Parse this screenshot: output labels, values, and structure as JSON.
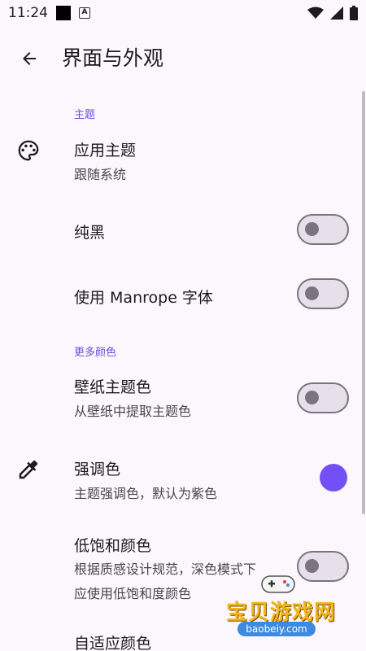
{
  "status_bar": {
    "time": "11:24",
    "icons": [
      "notification-square-icon",
      "a-badge-icon",
      "wifi-icon",
      "cell-signal-icon",
      "battery-icon"
    ]
  },
  "top_bar": {
    "back_icon": "arrow-back-icon",
    "title": "界面与外观"
  },
  "sections": {
    "theme": {
      "header": "主题",
      "app_theme": {
        "icon": "palette-icon",
        "title": "应用主题",
        "subtitle": "跟随系统"
      },
      "pure_black": {
        "title": "纯黑",
        "enabled": false
      },
      "manrope": {
        "title": "使用 Manrope 字体",
        "enabled": false
      }
    },
    "more_colors": {
      "header": "更多颜色",
      "wallpaper_color": {
        "title": "壁纸主题色",
        "subtitle": "从壁纸中提取主题色",
        "enabled": false
      },
      "accent_color": {
        "icon": "eyedropper-icon",
        "title": "强调色",
        "subtitle": "主题强调色，默认为紫色",
        "color": "#7350f5"
      },
      "low_saturation": {
        "title": "低饱和颜色",
        "subtitle_line1": "根据质感设计规范，深色模式下",
        "subtitle_line2": "应使用低饱和度颜色",
        "enabled": false
      },
      "adaptive_color": {
        "title": "自适应颜色"
      }
    }
  },
  "watermark": {
    "name": "宝贝游戏网",
    "url": "baobeiy.com"
  },
  "colors": {
    "background": "#fcf7fc",
    "accent": "#7350f5",
    "section_header": "#6a4fd6",
    "switch_outline": "#79747e"
  }
}
